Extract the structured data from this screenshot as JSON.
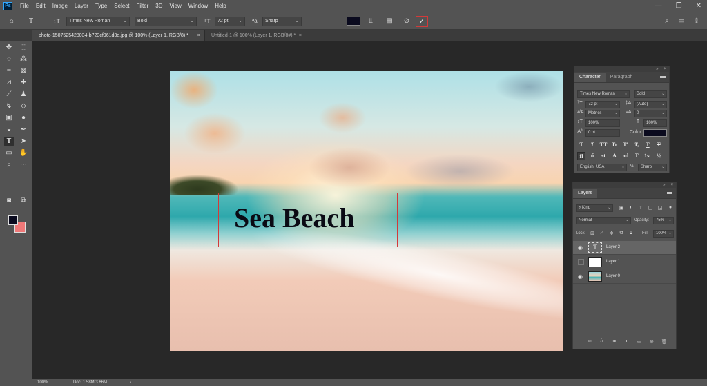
{
  "menu": {
    "logo": "Ps",
    "items": [
      "File",
      "Edit",
      "Image",
      "Layer",
      "Type",
      "Select",
      "Filter",
      "3D",
      "View",
      "Window",
      "Help"
    ],
    "window_controls": [
      "—",
      "❐",
      "✕"
    ]
  },
  "options": {
    "font_family": "Times New Roman",
    "font_style": "Bold",
    "font_size": "72 pt",
    "aa_label": "ªa",
    "anti_alias": "Sharp",
    "text_color": "#0a0a1e",
    "commit_glyph": "✓",
    "cancel_glyph": "⊘"
  },
  "tabs": [
    {
      "label": "photo-1507525428034-b723cf961d3e.jpg @ 100% (Layer 1, RGB/8) *",
      "close": "×"
    },
    {
      "label": "Untitled-1 @ 100% (Layer 1, RGB/8#) *",
      "close": "×"
    }
  ],
  "canvas": {
    "text": "Sea Beach"
  },
  "colors": {
    "foreground": "#0a0a1e",
    "background": "#f07878",
    "accent_box": "#d23a3a"
  },
  "character": {
    "tabs": [
      "Character",
      "Paragraph"
    ],
    "font_family": "Times New Roman",
    "font_style": "Bold",
    "size": "72 pt",
    "leading": "(Auto)",
    "kerning": "Metrics",
    "tracking": "0",
    "vscale": "100%",
    "hscale": "100%",
    "baseline": "0 pt",
    "color_label": "Color:",
    "language": "English: USA",
    "anti_alias": "Sharp",
    "style_buttons": [
      "T",
      "T",
      "TT",
      "Tr",
      "T'",
      "T,",
      "T",
      "T"
    ],
    "feature_buttons": [
      "fi",
      "ő",
      "st",
      "A",
      "ad",
      "T",
      "1st",
      "½"
    ]
  },
  "layers": {
    "tab": "Layers",
    "filter": "Kind",
    "blend_mode": "Normal",
    "opacity_label": "Opacity:",
    "opacity": "75%",
    "lock_label": "Lock:",
    "fill_label": "Fill:",
    "fill": "100%",
    "items": [
      {
        "name": "Layer 2",
        "visible": true,
        "selected": true,
        "type": "text"
      },
      {
        "name": "Layer 1",
        "visible": false,
        "selected": false,
        "type": "white"
      },
      {
        "name": "Layer 0",
        "visible": true,
        "selected": false,
        "type": "photo"
      }
    ]
  },
  "status": {
    "zoom": "100%",
    "doc": "Doc: 1.58M/3.66M",
    "arrow": "›"
  }
}
